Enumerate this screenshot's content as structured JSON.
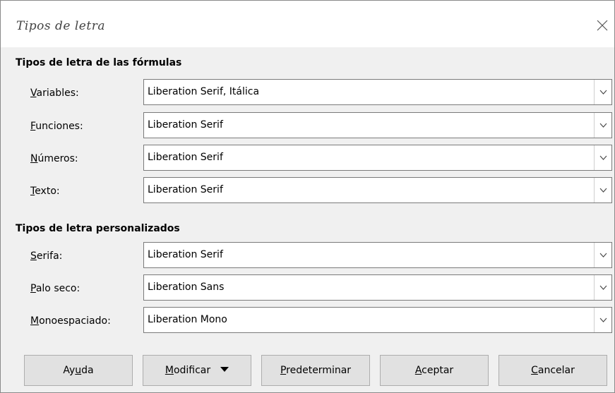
{
  "window": {
    "title": "Tipos de letra"
  },
  "formula_fonts": {
    "heading": "Tipos de letra de las fórmulas",
    "rows": [
      {
        "mnemonic": "V",
        "rest": "ariables:",
        "value": "Liberation Serif, Itálica"
      },
      {
        "mnemonic": "F",
        "rest": "unciones:",
        "value": "Liberation Serif"
      },
      {
        "mnemonic": "N",
        "rest": "úmeros:",
        "value": "Liberation Serif"
      },
      {
        "mnemonic": "T",
        "rest": "exto:",
        "value": "Liberation Serif"
      }
    ]
  },
  "custom_fonts": {
    "heading": "Tipos de letra personalizados",
    "rows": [
      {
        "mnemonic": "S",
        "rest": "erifa:",
        "value": "Liberation Serif"
      },
      {
        "mnemonic": "P",
        "rest": "alo seco:",
        "value": "Liberation Sans"
      },
      {
        "mnemonic": "M",
        "rest": "onoespaciado:",
        "value": "Liberation Mono"
      }
    ]
  },
  "buttons": {
    "help": {
      "pre": "Ay",
      "mnemonic": "u",
      "post": "da"
    },
    "modify": {
      "pre": "",
      "mnemonic": "M",
      "post": "odificar"
    },
    "default": {
      "pre": "",
      "mnemonic": "P",
      "post": "redeterminar"
    },
    "ok": {
      "pre": "",
      "mnemonic": "A",
      "post": "ceptar"
    },
    "cancel": {
      "pre": "",
      "mnemonic": "C",
      "post": "ancelar"
    }
  },
  "icons": {
    "close": "close-icon",
    "dropdown": "chevron-down-icon",
    "menu_arrow": "triangle-down-icon"
  },
  "colors": {
    "dialog_bg": "#f0f0f0",
    "button_bg": "#e1e1e1",
    "border": "#7a7a7a"
  }
}
